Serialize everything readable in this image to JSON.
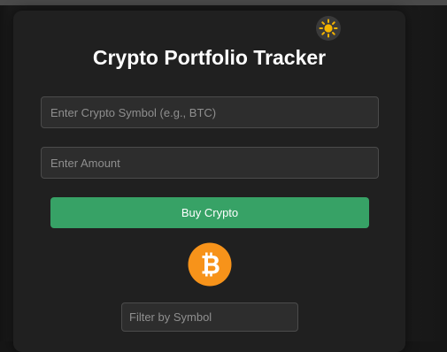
{
  "app": {
    "title": "Crypto Portfolio Tracker"
  },
  "theme_toggle": {
    "icon": "sun-icon"
  },
  "form": {
    "symbol_placeholder": "Enter Crypto Symbol (e.g., BTC)",
    "symbol_value": "",
    "amount_placeholder": "Enter Amount",
    "amount_value": "",
    "buy_label": "Buy Crypto"
  },
  "coin": {
    "icon": "bitcoin-icon",
    "color": "#f7931a"
  },
  "filter": {
    "placeholder": "Filter by Symbol",
    "value": ""
  },
  "colors": {
    "background": "#1a1a1a",
    "card": "#202020",
    "input_bg": "#2d2d2d",
    "accent_green": "#37a266",
    "bitcoin_orange": "#f7931a"
  }
}
